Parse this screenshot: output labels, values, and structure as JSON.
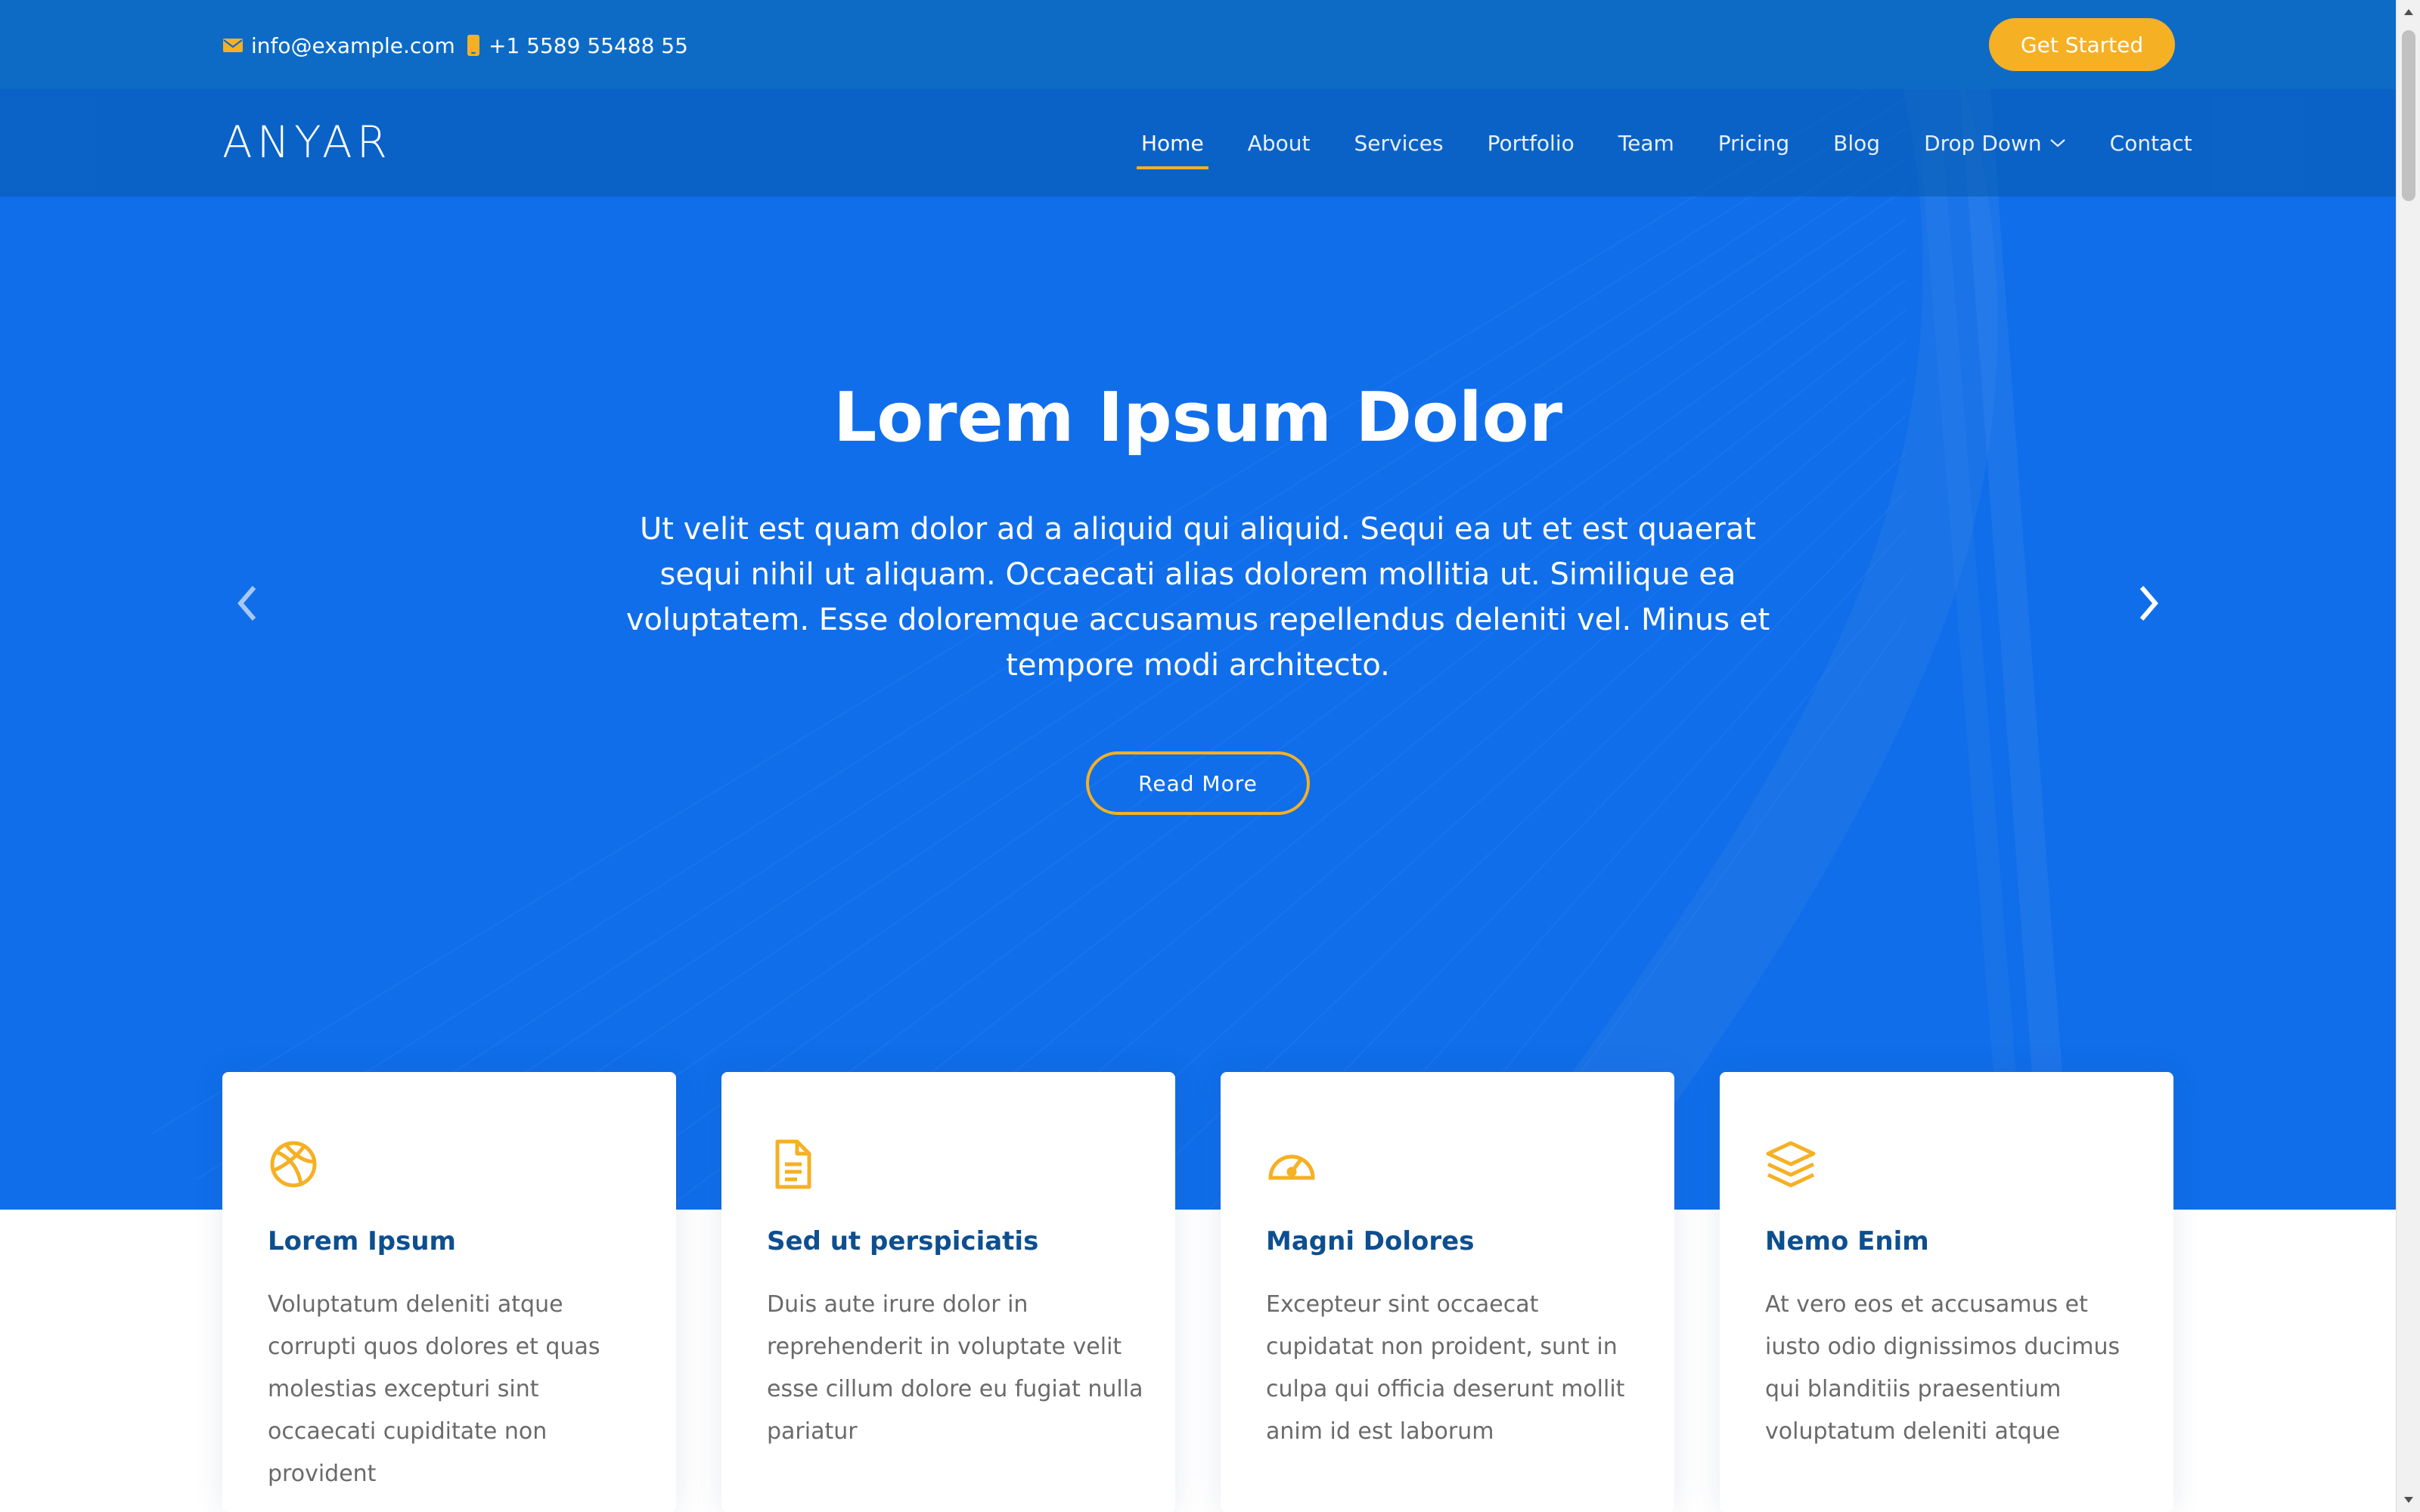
{
  "colors": {
    "primary": "#106eea",
    "accent": "#f6b024",
    "card_title": "#0d4f8f",
    "card_text": "#6a6a6a"
  },
  "topbar": {
    "email": "info@example.com",
    "email_icon": "envelope-icon",
    "phone": "+1 5589 55488 55",
    "phone_icon": "phone-icon",
    "cta_label": "Get Started"
  },
  "header": {
    "logo": "ANYAR",
    "nav": [
      {
        "label": "Home",
        "active": true
      },
      {
        "label": "About"
      },
      {
        "label": "Services"
      },
      {
        "label": "Portfolio"
      },
      {
        "label": "Team"
      },
      {
        "label": "Pricing"
      },
      {
        "label": "Blog"
      },
      {
        "label": "Drop Down",
        "icon": "chevron-down-icon"
      },
      {
        "label": "Contact"
      }
    ]
  },
  "hero": {
    "title": "Lorem Ipsum Dolor",
    "text": "Ut velit est quam dolor ad a aliquid qui aliquid. Sequi ea ut et est quaerat sequi nihil ut aliquam. Occaecati alias dolorem mollitia ut. Similique ea voluptatem. Esse doloremque accusamus repellendus deleniti vel. Minus et tempore modi architecto.",
    "button_label": "Read More",
    "prev_icon": "chevron-left-icon",
    "next_icon": "chevron-right-icon"
  },
  "features": [
    {
      "icon": "basketball-icon",
      "title": "Lorem Ipsum",
      "text": "Voluptatum deleniti atque corrupti quos dolores et quas molestias excepturi sint occaecati cupiditate non provident"
    },
    {
      "icon": "document-icon",
      "title": "Sed ut perspiciatis",
      "text": "Duis aute irure dolor in reprehenderit in voluptate velit esse cillum dolore eu fugiat nulla pariatur"
    },
    {
      "icon": "tachometer-icon",
      "title": "Magni Dolores",
      "text": "Excepteur sint occaecat cupidatat non proident, sunt in culpa qui officia deserunt mollit anim id est laborum"
    },
    {
      "icon": "layers-icon",
      "title": "Nemo Enim",
      "text": "At vero eos et accusamus et iusto odio dignissimos ducimus qui blanditiis praesentium voluptatum deleniti atque"
    }
  ]
}
